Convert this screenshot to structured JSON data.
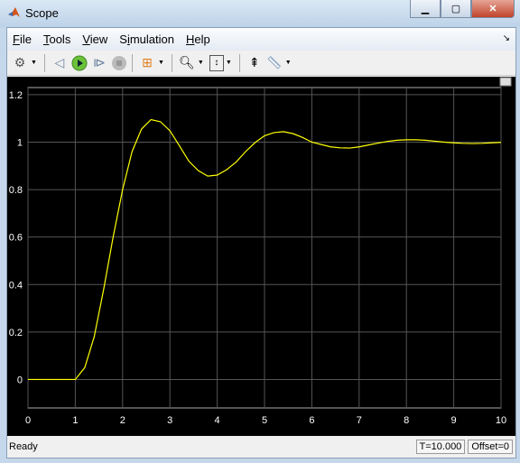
{
  "window": {
    "title": "Scope",
    "buttons": [
      "minimize",
      "maximize",
      "close"
    ]
  },
  "menu": [
    {
      "label": "File",
      "u": "F",
      "rest": "ile"
    },
    {
      "label": "Tools",
      "u": "T",
      "rest": "ools"
    },
    {
      "label": "View",
      "u": "V",
      "rest": "iew"
    },
    {
      "label": "Simulation",
      "u": "",
      "pre": "S",
      "u2": "i",
      "rest": "mulation"
    },
    {
      "label": "Help",
      "u": "H",
      "rest": "elp"
    }
  ],
  "toolbar": [
    "parameters-gear",
    "step-back",
    "run",
    "step-forward",
    "stop",
    "highlight-block",
    "zoom-in",
    "scale-axes",
    "signal-selector",
    "measurements"
  ],
  "status": {
    "ready": "Ready",
    "time": "T=10.000",
    "offset": "Offset=0"
  },
  "chart_data": {
    "type": "line",
    "xlim": [
      0,
      10
    ],
    "ylim": [
      -0.12,
      1.23
    ],
    "xticks": [
      0,
      1,
      2,
      3,
      4,
      5,
      6,
      7,
      8,
      9,
      10
    ],
    "yticks": [
      0,
      0.2,
      0.4,
      0.6,
      0.8,
      1,
      1.2
    ],
    "grid": true,
    "line_color": "#ffff00",
    "background": "#000000",
    "x": [
      0,
      1,
      1.2,
      1.4,
      1.6,
      1.8,
      2.0,
      2.2,
      2.4,
      2.6,
      2.8,
      3.0,
      3.2,
      3.4,
      3.6,
      3.8,
      4.0,
      4.2,
      4.4,
      4.6,
      4.8,
      5.0,
      5.2,
      5.4,
      5.6,
      5.8,
      6.0,
      6.2,
      6.4,
      6.6,
      6.8,
      7.0,
      7.2,
      7.4,
      7.6,
      7.8,
      8.0,
      8.2,
      8.4,
      8.6,
      8.8,
      9.0,
      9.2,
      9.4,
      9.6,
      9.8,
      10
    ],
    "y": [
      0,
      0,
      0.05,
      0.18,
      0.38,
      0.6,
      0.8,
      0.96,
      1.055,
      1.095,
      1.086,
      1.048,
      0.985,
      0.92,
      0.88,
      0.857,
      0.861,
      0.884,
      0.916,
      0.96,
      0.998,
      1.027,
      1.04,
      1.044,
      1.036,
      1.02,
      1.0,
      0.99,
      0.98,
      0.976,
      0.975,
      0.98,
      0.988,
      0.996,
      1.003,
      1.008,
      1.01,
      1.01,
      1.008,
      1.004,
      1.0,
      0.997,
      0.995,
      0.994,
      0.995,
      0.997,
      0.999
    ]
  }
}
